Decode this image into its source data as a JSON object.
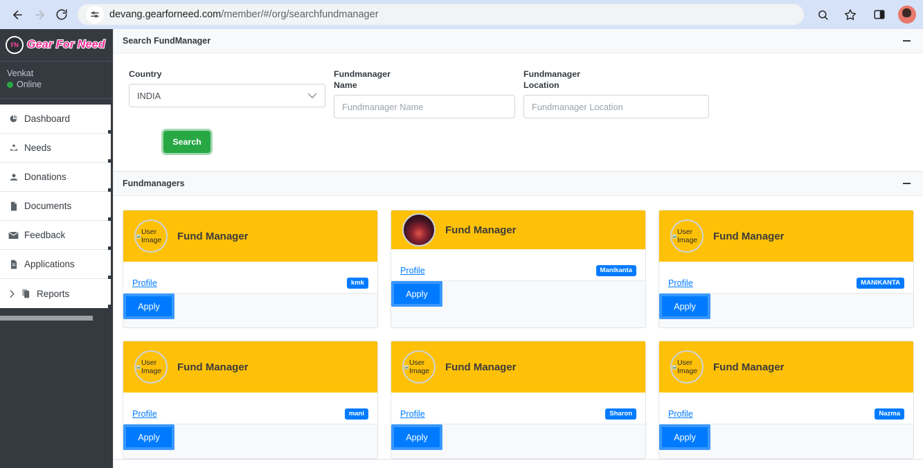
{
  "browser": {
    "back_icon": "back-arrow-icon",
    "forward_icon": "forward-arrow-icon",
    "reload_icon": "reload-icon",
    "site_info_icon": "site-settings-icon",
    "url_prefix": "devang.gearforneed.com",
    "url_path": "/member/#/org/searchfundmanager",
    "url_full": "devang.gearforneed.com/member/#/org/searchfundmanager",
    "zoom_icon": "search-zoom-icon",
    "bookmark_icon": "star-bookmark-icon",
    "sidepanel_icon": "side-panel-icon",
    "profile_icon": "profile-avatar-icon"
  },
  "sidebar": {
    "brand_mark": "FN",
    "brand_text": "Gear For Need",
    "user_name": "Venkat",
    "user_status": "Online",
    "status_color": "#28a745",
    "items": [
      {
        "label": "Dashboard",
        "icon": "pie-chart-icon",
        "has_chevron": false
      },
      {
        "label": "Needs",
        "icon": "hand-heart-icon",
        "has_chevron": false
      },
      {
        "label": "Donations",
        "icon": "donate-hand-icon",
        "has_chevron": false
      },
      {
        "label": "Documents",
        "icon": "document-icon",
        "has_chevron": false
      },
      {
        "label": "Feedback",
        "icon": "envelope-icon",
        "has_chevron": false
      },
      {
        "label": "Applications",
        "icon": "file-list-icon",
        "has_chevron": false
      },
      {
        "label": "Reports",
        "icon": "copy-files-icon",
        "has_chevron": true
      }
    ]
  },
  "search_panel": {
    "title": "Search FundManager",
    "minimize_icon": "minimize-icon",
    "country": {
      "label": "Country",
      "value": "INDIA",
      "chevron_icon": "chevron-down-icon"
    },
    "fundmanager_name": {
      "label_line1": "Fundmanager",
      "label_line2": "Name",
      "value": "",
      "placeholder": "Fundmanager Name"
    },
    "fundmanager_location": {
      "label_line1": "Fundmanager",
      "label_line2": "Location",
      "value": "",
      "placeholder": "Fundmanager Location"
    },
    "search_button": "Search",
    "search_button_color": "#28a745"
  },
  "fundmanagers_panel": {
    "title": "Fundmanagers",
    "minimize_icon": "minimize-icon",
    "header_color": "#ffc107",
    "badge_color": "#007bff",
    "cards": [
      {
        "name": "Fund Manager",
        "avatar": "broken",
        "avatar_alt": "User Image",
        "profile_label": "Profile",
        "badge": "kmk",
        "apply_label": "Apply",
        "short": false
      },
      {
        "name": "Fund Manager",
        "avatar": "photo",
        "avatar_alt": "",
        "profile_label": "Profile",
        "badge": "Manikanta",
        "apply_label": "Apply",
        "short": true
      },
      {
        "name": "Fund Manager",
        "avatar": "broken",
        "avatar_alt": "User Image",
        "profile_label": "Profile",
        "badge": "MANIKANTA",
        "apply_label": "Apply",
        "short": false
      },
      {
        "name": "Fund Manager",
        "avatar": "broken",
        "avatar_alt": "User Image",
        "profile_label": "Profile",
        "badge": "mani",
        "apply_label": "Apply",
        "short": false
      },
      {
        "name": "Fund Manager",
        "avatar": "broken",
        "avatar_alt": "User Image",
        "profile_label": "Profile",
        "badge": "Sharon",
        "apply_label": "Apply",
        "short": false
      },
      {
        "name": "Fund Manager",
        "avatar": "broken",
        "avatar_alt": "User Image",
        "profile_label": "Profile",
        "badge": "Nazma",
        "apply_label": "Apply",
        "short": false
      }
    ]
  }
}
